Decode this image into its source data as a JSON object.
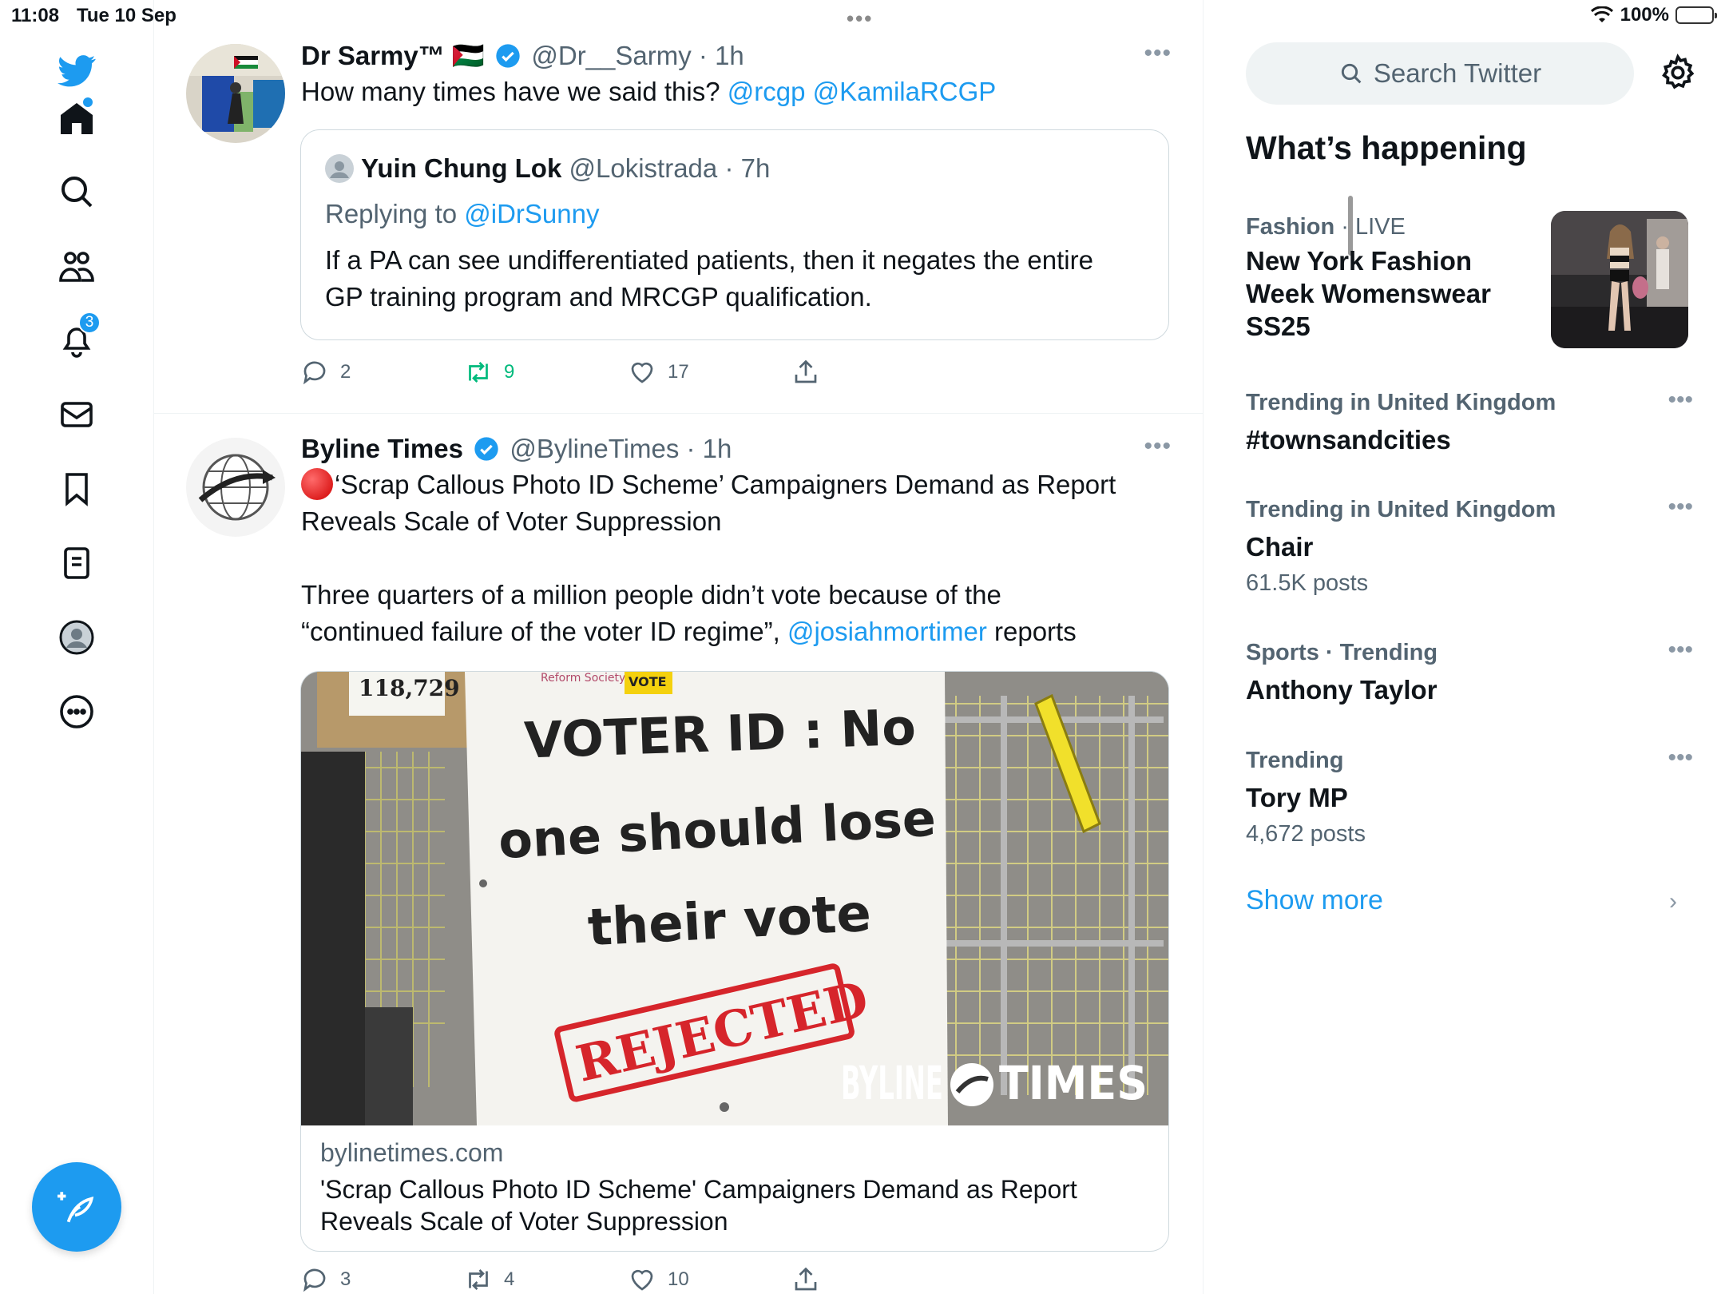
{
  "status_bar": {
    "time": "11:08",
    "date": "Tue 10 Sep",
    "battery": "100%"
  },
  "nav": {
    "notifications_badge": "3"
  },
  "tweets": [
    {
      "name": "Dr Sarmy™",
      "flag": "🇵🇸",
      "handle": "@Dr__Sarmy",
      "time": "· 1h",
      "text_plain": "How many times have we said this? ",
      "mention1": "@rcgp",
      "mention2": "@KamilaRCGP",
      "quote": {
        "name": "Yuin Chung Lok",
        "handle": "@Lokistrada",
        "time": "· 7h",
        "replying_prefix": "Replying to ",
        "replying_handle": "@iDrSunny",
        "text_line1": "If a PA can see undifferentiated patients, then it negates the entire",
        "text_line2": "GP training program and MRCGP qualification."
      },
      "actions": {
        "replies": "2",
        "retweets": "9",
        "likes": "17"
      }
    },
    {
      "name": "Byline Times",
      "handle": "@BylineTimes",
      "time": "· 1h",
      "headline_line1": "‘Scrap Callous Photo ID Scheme’ Campaigners Demand as Report",
      "headline_line2": "Reveals Scale of Voter Suppression",
      "body_line1": "Three quarters of a million people didn’t vote because of the",
      "body_line2_prefix": "“continued failure of the voter ID regime”, ",
      "body_mention": "@josiahmortimer",
      "body_line2_suffix": " reports",
      "card": {
        "image_text": {
          "box_number": "118,729",
          "sign_line1": "VOTER ID : No",
          "sign_line2": "one should lose",
          "sign_line3": "their vote",
          "stamp": "REJECTED",
          "small_top1": "Reform Society",
          "small_top2": "VOTE",
          "watermark_left": "BYLINE",
          "watermark_right": "TIMES"
        },
        "domain": "bylinetimes.com",
        "title_line1": "'Scrap Callous Photo ID Scheme' Campaigners Demand as Report",
        "title_line2": "Reveals Scale of Voter Suppression"
      },
      "actions": {
        "replies": "3",
        "retweets": "4",
        "likes": "10"
      }
    }
  ],
  "sidebar": {
    "search_placeholder": "Search Twitter",
    "section_title": "What’s happening",
    "trends": [
      {
        "category": "Fashion",
        "live": " · LIVE",
        "title_lines": [
          "New York Fashion",
          "Week Womenswear",
          "SS25"
        ]
      },
      {
        "category": "Trending in United Kingdom",
        "title": "#townsandcities"
      },
      {
        "category": "Trending in United Kingdom",
        "title": "Chair",
        "count": "61.5K posts"
      },
      {
        "category": "Sports · Trending",
        "title": "Anthony Taylor"
      },
      {
        "category": "Trending",
        "title": "Tory MP",
        "count": "4,672 posts"
      }
    ],
    "show_more": "Show more"
  },
  "colors": {
    "accent": "#1d9bf0",
    "retweet_green": "#00ba7c",
    "secondary_text": "#536471"
  }
}
